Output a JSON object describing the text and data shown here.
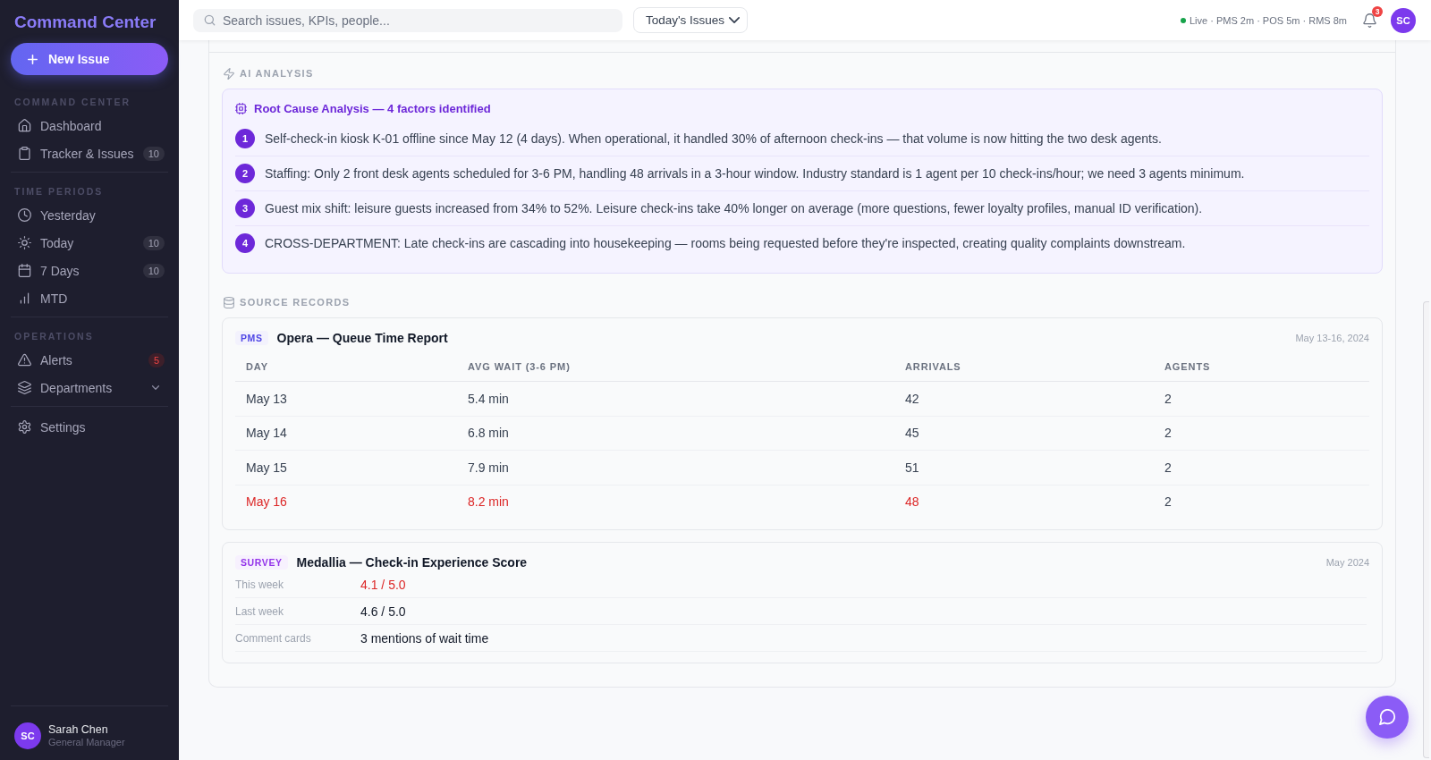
{
  "sidebar": {
    "brand": "Command Center",
    "new_issue_button": {
      "label": "New Issue"
    },
    "sections": [
      {
        "title": "COMMAND CENTER",
        "items": [
          {
            "label": "Dashboard",
            "kind": "link",
            "selected": false
          },
          {
            "label": "Tracker & Issues",
            "kind": "link",
            "selected": false,
            "badge": {
              "text": "10",
              "kind": "neutral"
            }
          }
        ]
      },
      {
        "title": "TIME PERIODS",
        "items": [
          {
            "label": "Yesterday",
            "kind": "link",
            "selected": false
          },
          {
            "label": "Today",
            "kind": "link",
            "selected": false,
            "badge": {
              "text": "10",
              "kind": "neutral"
            }
          },
          {
            "label": "7 Days",
            "kind": "link",
            "selected": false,
            "badge": {
              "text": "10",
              "kind": "neutral"
            }
          },
          {
            "label": "MTD",
            "kind": "link",
            "selected": false
          }
        ]
      },
      {
        "title": "OPERATIONS",
        "items": [
          {
            "label": "Alerts",
            "kind": "link",
            "selected": false,
            "badge": {
              "text": "5",
              "kind": "alert"
            }
          },
          {
            "label": "Departments",
            "kind": "group",
            "selected": false,
            "expanded": false
          }
        ]
      },
      {
        "items": [
          {
            "label": "Settings",
            "kind": "link",
            "selected": false
          }
        ]
      }
    ],
    "user": {
      "initials": "SC",
      "name": "Sarah Chen",
      "role": "General Manager"
    }
  },
  "top_bar": {
    "search": {
      "placeholder": "Search issues, KPIs, people..."
    },
    "view_select": {
      "value": "Today's Issues"
    },
    "sync_status": {
      "online": true,
      "text": "Live · PMS 2m · POS 5m · RMS 8m"
    },
    "notifications": {
      "count": "3"
    },
    "avatar": {
      "initials": "SC"
    }
  },
  "ai_analysis": {
    "heading": "AI ANALYSIS",
    "title": "Root Cause Analysis — 4 factors identified",
    "factors": [
      {
        "number": "1",
        "text": "Self-check-in kiosk K-01 offline since May 12 (4 days). When operational, it handled 30% of afternoon check-ins — that volume is now hitting the two desk agents."
      },
      {
        "number": "2",
        "text": "Staffing: Only 2 front desk agents scheduled for 3-6 PM, handling 48 arrivals in a 3-hour window. Industry standard is 1 agent per 10 check-ins/hour; we need 3 agents minimum."
      },
      {
        "number": "3",
        "text": "Guest mix shift: leisure guests increased from 34% to 52%. Leisure check-ins take 40% longer on average (more questions, fewer loyalty profiles, manual ID verification)."
      },
      {
        "number": "4",
        "text": "CROSS-DEPARTMENT: Late check-ins are cascading into housekeeping — rooms being requested before they're inspected, creating quality complaints downstream."
      }
    ]
  },
  "source_records": {
    "heading": "SOURCE RECORDS",
    "records": [
      {
        "kind": "table",
        "tag": {
          "text": "PMS",
          "color": "#4f46e5"
        },
        "title": "Opera — Queue Time Report",
        "date": "May 13-16, 2024",
        "columns": [
          "DAY",
          "AVG WAIT (3-6 PM)",
          "ARRIVALS",
          "AGENTS"
        ],
        "rows": [
          {
            "cells": [
              {
                "text": "May 13",
                "alert": false
              },
              {
                "text": "5.4 min",
                "alert": false
              },
              {
                "text": "42",
                "alert": false
              },
              {
                "text": "2",
                "alert": false
              }
            ]
          },
          {
            "cells": [
              {
                "text": "May 14",
                "alert": false
              },
              {
                "text": "6.8 min",
                "alert": false
              },
              {
                "text": "45",
                "alert": false
              },
              {
                "text": "2",
                "alert": false
              }
            ]
          },
          {
            "cells": [
              {
                "text": "May 15",
                "alert": false
              },
              {
                "text": "7.9 min",
                "alert": false
              },
              {
                "text": "51",
                "alert": false
              },
              {
                "text": "2",
                "alert": false
              }
            ]
          },
          {
            "cells": [
              {
                "text": "May 16",
                "alert": true
              },
              {
                "text": "8.2 min",
                "alert": true
              },
              {
                "text": "48",
                "alert": true
              },
              {
                "text": "2",
                "alert": false
              }
            ]
          }
        ]
      },
      {
        "kind": "metrics",
        "tag": {
          "text": "SURVEY",
          "color": "#9333ea"
        },
        "title": "Medallia — Check-in Experience Score",
        "date": "May 2024",
        "rows": [
          {
            "label": "This week",
            "value": "4.1 / 5.0",
            "alert": true
          },
          {
            "label": "Last week",
            "value": "4.6 / 5.0",
            "alert": false
          },
          {
            "label": "Comment cards",
            "value": "3 mentions of wait time",
            "alert": false
          }
        ]
      }
    ]
  }
}
